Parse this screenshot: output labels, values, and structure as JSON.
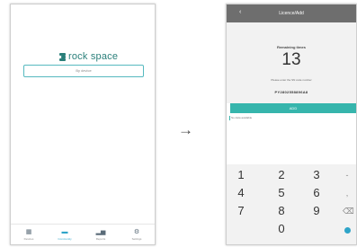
{
  "left_screen": {
    "logo_text": "rock space",
    "search_placeholder": "By device",
    "bottom_nav": [
      {
        "icon": "grid-icon",
        "label": "Devices"
      },
      {
        "icon": "folder-icon",
        "label": "Community"
      },
      {
        "icon": "chart-icon",
        "label": "Reports"
      },
      {
        "icon": "gear-icon",
        "label": "Settings"
      }
    ],
    "active_nav_index": 1
  },
  "arrow": "→",
  "right_screen": {
    "back_label": "‹",
    "title": "Licence/Add",
    "remaining_label": "Remaining times",
    "remaining_count": "13",
    "instruction": "Please enter the SN code number",
    "serial": "PY2802558896A8",
    "add_label": "ADD",
    "list_item": "No data available",
    "keys": [
      "1",
      "2",
      "3",
      "4",
      "5",
      "6",
      "7",
      "8",
      "9",
      "0"
    ],
    "side_keys": [
      "-",
      ",",
      "⌫"
    ],
    "accent_color": "#36b5ac"
  }
}
